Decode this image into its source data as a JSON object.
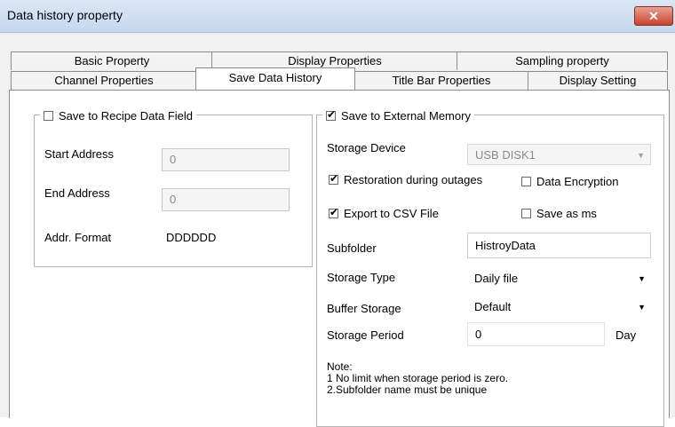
{
  "window": {
    "title": "Data history property",
    "close_label": "✕"
  },
  "tabs_row1": [
    {
      "label": "Basic Property"
    },
    {
      "label": "Display Properties"
    },
    {
      "label": "Sampling property"
    }
  ],
  "tabs_row2": [
    {
      "label": "Channel Properties"
    },
    {
      "label": "Save Data History"
    },
    {
      "label": "Title Bar Properties"
    },
    {
      "label": "Display Setting"
    }
  ],
  "recipe": {
    "legend": "Save to Recipe Data Field",
    "checked": false,
    "start_label": "Start Address",
    "start_value": "0",
    "end_label": "End Address",
    "end_value": "0",
    "format_label": "Addr. Format",
    "format_value": "DDDDDD"
  },
  "external": {
    "legend": "Save to External Memory",
    "checked": true,
    "storage_device_label": "Storage Device",
    "storage_device_value": "USB DISK1",
    "restoration_label": "Restoration during outages",
    "restoration_checked": true,
    "encryption_label": "Data Encryption",
    "encryption_checked": false,
    "csv_label": "Export to CSV File",
    "csv_checked": true,
    "save_ms_label": "Save as ms",
    "save_ms_checked": false,
    "subfolder_label": "Subfolder",
    "subfolder_value": "HistroyData",
    "storage_type_label": "Storage Type",
    "storage_type_value": "Daily file",
    "buffer_label": "Buffer Storage",
    "buffer_value": "Default",
    "period_label": "Storage Period",
    "period_value": "0",
    "period_unit": "Day",
    "note_title": "Note:",
    "note_line1": "1 No limit when storage period is zero.",
    "note_line2": "2.Subfolder name must be unique"
  }
}
